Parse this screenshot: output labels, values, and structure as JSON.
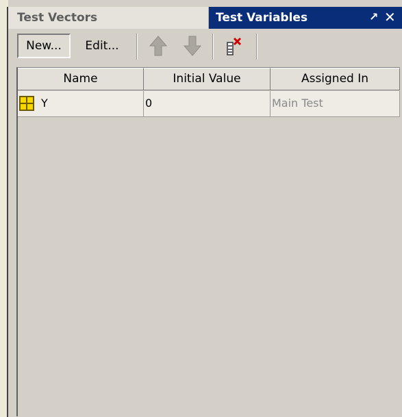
{
  "tabs": {
    "inactive_label": "Test Vectors",
    "active_label": "Test Variables",
    "pin_glyph": "↗",
    "close_glyph": "✕"
  },
  "toolbar": {
    "new_label": "New...",
    "edit_label": "Edit...",
    "move_up_icon": "up-arrow-icon",
    "move_down_icon": "down-arrow-icon",
    "delete_icon": "delete-variable-icon"
  },
  "table": {
    "columns": [
      "Name",
      "Initial Value",
      "Assigned In"
    ],
    "rows": [
      {
        "name": "Y",
        "icon": "variable-grid-icon",
        "initial_value": "0",
        "assigned_in": "Main Test"
      }
    ]
  },
  "colors": {
    "active_tab": "#0a2d7a",
    "panel_bg": "#d4d0c8",
    "icon_yellow": "#f6d800",
    "delete_red": "#d00000"
  }
}
